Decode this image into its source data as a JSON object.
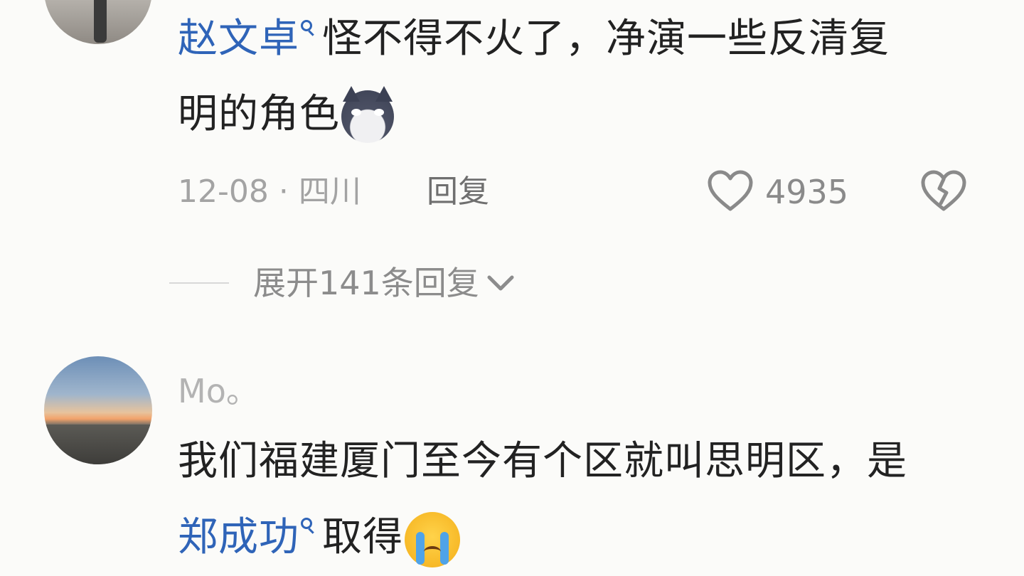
{
  "comment1": {
    "username": "赵文卓",
    "text_line1": "怪不得不火了，净演一些反清复",
    "text_line2": "明的角色",
    "emoji": "wolf-emoji",
    "date": "12-08",
    "separator": "·",
    "location": "四川",
    "reply_label": "回复",
    "like_count": "4935",
    "expand_replies_label": "展开141条回复"
  },
  "comment2": {
    "username": "Mo。",
    "text_line1": "我们福建厦门至今有个区就叫思明区，是",
    "link_text": "郑成功",
    "text_line2_rest": "取得",
    "emoji": "crying-face-emoji"
  },
  "colors": {
    "link": "#2f64b8",
    "meta": "#a3a3a3",
    "background": "#fbfbf9"
  }
}
